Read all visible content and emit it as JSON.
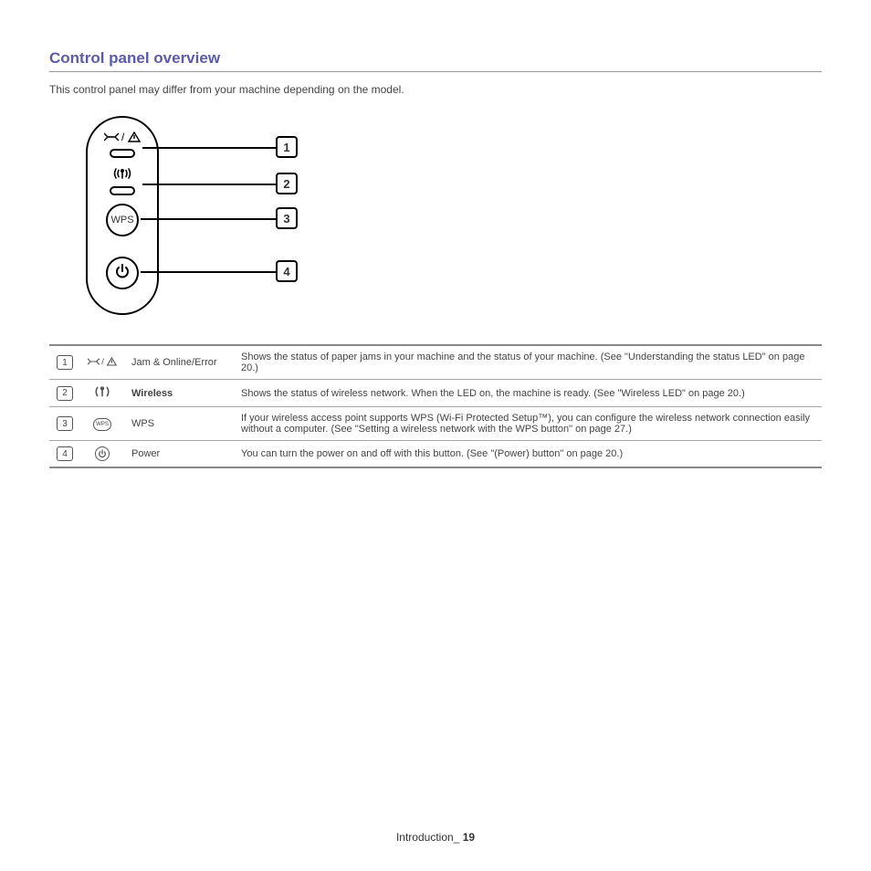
{
  "title": "Control panel overview",
  "intro": "This control panel may differ from your machine depending on the model.",
  "diagram": {
    "wps_label": "WPS",
    "callouts": [
      "1",
      "2",
      "3",
      "4"
    ]
  },
  "rows": [
    {
      "num": "1",
      "name": "Jam & Online/Error",
      "name_bold": false,
      "desc": "Shows the status of paper jams in your machine and the status of your machine. (See \"Understanding the status LED\" on page 20.)"
    },
    {
      "num": "2",
      "name": "Wireless",
      "name_bold": true,
      "desc": "Shows the status of wireless network. When the LED on, the machine is ready. (See \"Wireless LED\" on page 20.)"
    },
    {
      "num": "3",
      "name": "WPS",
      "name_bold": false,
      "desc": "If your wireless access point supports WPS (Wi-Fi Protected Setup™), you can configure the wireless network connection easily without a computer. (See \"Setting a wireless network with the WPS button\" on page 27.)"
    },
    {
      "num": "4",
      "name": "Power",
      "name_bold": false,
      "desc": "You can turn the power on and off with this button. (See \"(Power) button\" on page 20.)"
    }
  ],
  "footer": {
    "section": "Introduction",
    "sep": "_ ",
    "page": "19"
  }
}
